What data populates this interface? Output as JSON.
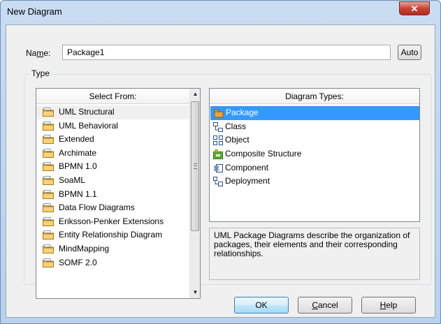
{
  "window": {
    "title": "New Diagram",
    "close_glyph": "✕"
  },
  "name_field": {
    "label_pre": "Na",
    "label_mnemonic": "m",
    "label_post": "e:",
    "value": "Package1",
    "auto_label": "Auto"
  },
  "type_group": {
    "label": "Type"
  },
  "select_from": {
    "header": "Select From:",
    "items": [
      "UML Structural",
      "UML Behavioral",
      "Extended",
      "Archimate",
      "BPMN 1.0",
      "SoaML",
      "BPMN 1.1",
      "Data Flow Diagrams",
      "Eriksson-Penker Extensions",
      "Entity Relationship Diagram",
      "MindMapping",
      "SOMF 2.0"
    ],
    "selected_index": 0,
    "scroll_up": "▲",
    "scroll_down": "▼"
  },
  "diagram_types": {
    "header": "Diagram Types:",
    "items": [
      {
        "label": "Package",
        "icon": "package-diagram-icon"
      },
      {
        "label": "Class",
        "icon": "class-diagram-icon"
      },
      {
        "label": "Object",
        "icon": "object-diagram-icon"
      },
      {
        "label": "Composite Structure",
        "icon": "composite-structure-icon"
      },
      {
        "label": "Component",
        "icon": "component-diagram-icon"
      },
      {
        "label": "Deployment",
        "icon": "deployment-diagram-icon"
      }
    ],
    "selected_index": 0
  },
  "description": "UML Package Diagrams describe the organization of packages, their elements and their corresponding relationships.",
  "buttons": {
    "ok": "OK",
    "cancel_mnemonic": "C",
    "cancel_rest": "ancel",
    "help_mnemonic": "H",
    "help_rest": "elp"
  },
  "colors": {
    "selection": "#3399ff",
    "title_bar": "#c9dcf2",
    "close_button": "#c7463a"
  }
}
